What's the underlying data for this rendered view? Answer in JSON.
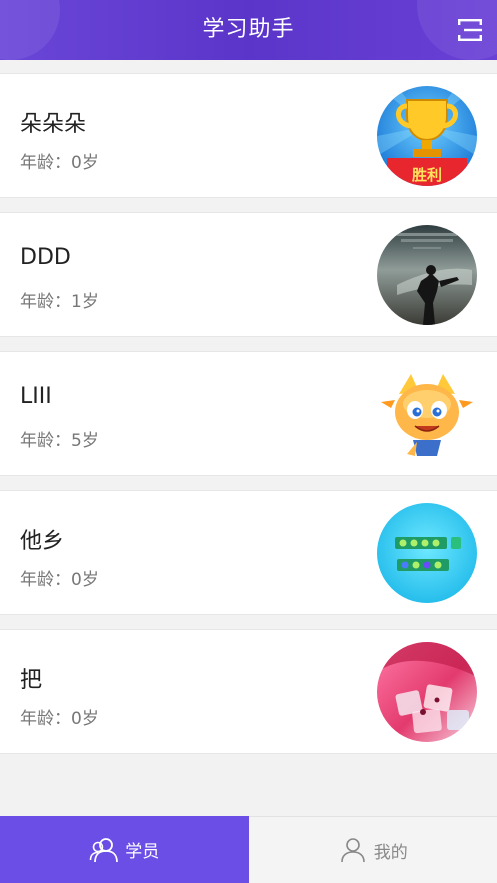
{
  "header": {
    "title": "学习助手",
    "menu_icon": "menu-icon"
  },
  "students": [
    {
      "name": "朵朵朵",
      "age_label": "年龄：",
      "age": "0岁",
      "avatar": "trophy-victory-avatar"
    },
    {
      "name": "DDD",
      "age_label": "年龄：",
      "age": "1岁",
      "avatar": "silhouette-man-avatar"
    },
    {
      "name": "LIII",
      "age_label": "年龄：",
      "age": "5岁",
      "avatar": "cartoon-dragon-avatar"
    },
    {
      "name": "他乡",
      "age_label": "年龄：",
      "age": "0岁",
      "avatar": "game-blocks-avatar"
    },
    {
      "name": "把",
      "age_label": "年龄：",
      "age": "0岁",
      "avatar": "ice-cubes-avatar"
    }
  ],
  "tabs": [
    {
      "label": "学员",
      "icon": "students-icon",
      "active": true
    },
    {
      "label": "我的",
      "icon": "profile-icon",
      "active": false
    }
  ],
  "colors": {
    "header": "#5b35c9",
    "tab_active": "#6b4ee6",
    "tab_inactive": "#f4f4f4"
  }
}
